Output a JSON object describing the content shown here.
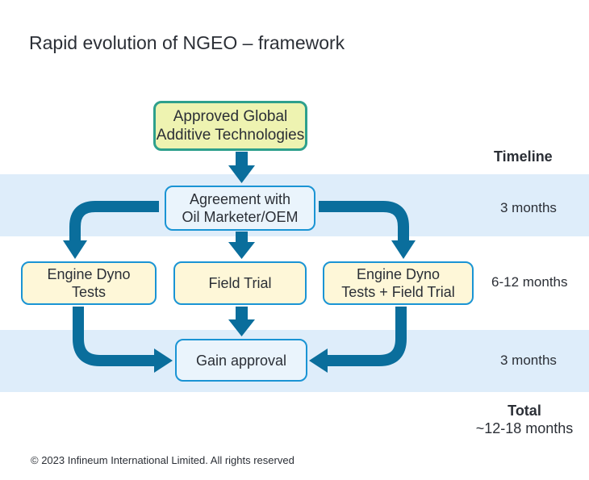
{
  "title": "Rapid evolution of NGEO – framework",
  "colors": {
    "band": "#deedfa",
    "arrow": "#0a6e9c",
    "box_border": "#1a94d4",
    "top_box_fill": "#eef3b1",
    "top_box_border": "#2ea08c",
    "step_box_fill": "#fef7d8",
    "light_box_fill": "#eaf4fc",
    "text": "#2b2f36"
  },
  "flow": {
    "start": {
      "line1": "Approved Global",
      "line2": "Additive Technologies"
    },
    "agreement": {
      "line1": "Agreement with",
      "line2": "Oil Marketer/OEM"
    },
    "paths": [
      {
        "line1": "Engine Dyno",
        "line2": "Tests"
      },
      {
        "line1": "Field Trial",
        "line2": ""
      },
      {
        "line1": "Engine Dyno",
        "line2": "Tests + Field Trial"
      }
    ],
    "end": {
      "label": "Gain approval"
    },
    "connections": [
      {
        "from": "start",
        "to": "agreement"
      },
      {
        "from": "agreement",
        "to": "paths.0"
      },
      {
        "from": "agreement",
        "to": "paths.1"
      },
      {
        "from": "agreement",
        "to": "paths.2"
      },
      {
        "from": "paths.0",
        "to": "end"
      },
      {
        "from": "paths.1",
        "to": "end"
      },
      {
        "from": "paths.2",
        "to": "end"
      }
    ]
  },
  "timeline": {
    "heading": "Timeline",
    "stages": [
      "3 months",
      "6-12 months",
      "3 months"
    ],
    "total_label": "Total",
    "total_value": "~12-18 months"
  },
  "footer": {
    "copyright": "© 2023 Infineum International Limited. All rights reserved"
  }
}
